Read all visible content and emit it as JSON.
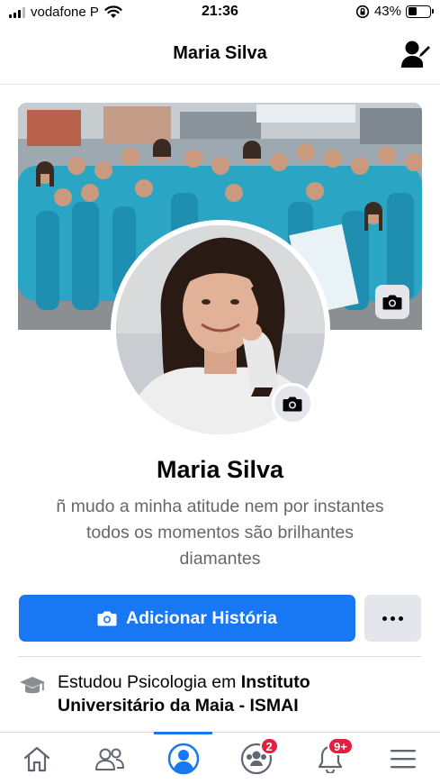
{
  "status_bar": {
    "carrier": "vodafone P",
    "time": "21:36",
    "battery": "43%",
    "battery_level": 0.43,
    "icons": [
      "signal-bars-icon",
      "wifi-icon",
      "orientation-lock-icon",
      "battery-icon"
    ]
  },
  "header": {
    "title": "Maria Silva",
    "edit_icon": "edit-profile-icon"
  },
  "profile": {
    "name": "Maria Silva",
    "bio_lines": [
      "ñ mudo a minha atitude nem por instantes",
      "todos os momentos são brilhantes",
      "diamantes"
    ]
  },
  "actions": {
    "add_story_label": "Adicionar História",
    "add_story_icon": "camera-icon",
    "more_icon": "more-dots-icon"
  },
  "education": {
    "icon": "graduation-cap-icon",
    "prefix": "Estudou Psicologia em ",
    "institution": "Instituto Universitário da Maia - ISMAI"
  },
  "nav": {
    "items": [
      {
        "name": "home",
        "icon": "home-icon"
      },
      {
        "name": "friends",
        "icon": "friends-icon"
      },
      {
        "name": "profile",
        "icon": "profile-icon",
        "active": true
      },
      {
        "name": "groups",
        "icon": "groups-icon",
        "badge": "2"
      },
      {
        "name": "notifications",
        "icon": "bell-icon",
        "badge": "9+"
      },
      {
        "name": "menu",
        "icon": "menu-icon"
      }
    ]
  },
  "colors": {
    "accent": "#1877f2",
    "badge": "#e41e3f",
    "secondary_text": "#65676b",
    "button_gray": "#e4e6eb",
    "teal_outfits": "#2aa6c4"
  }
}
